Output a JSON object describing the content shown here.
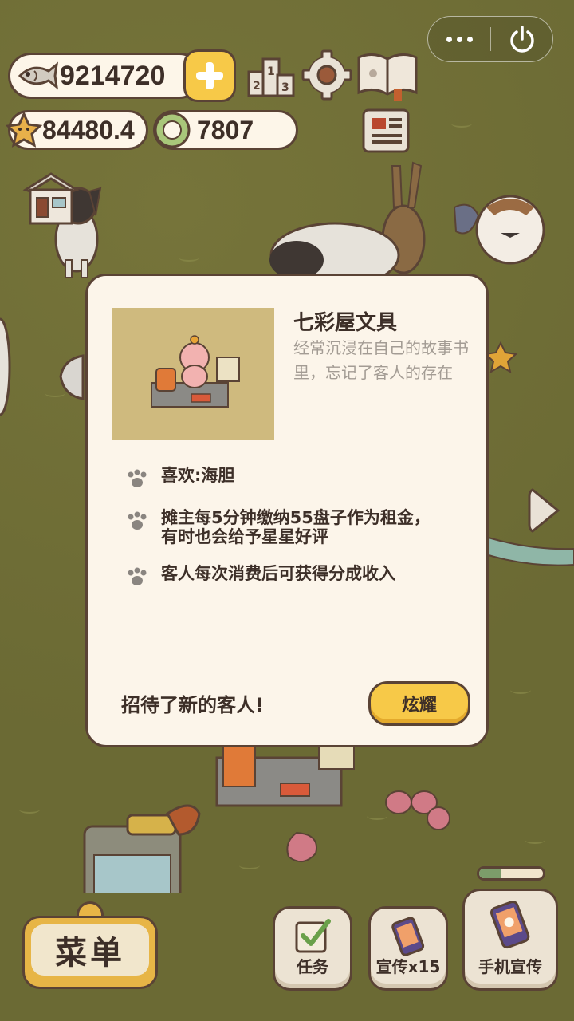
{
  "top_bar": {
    "fish_count": "9214720",
    "star_count": "84480.4",
    "coin_count": "7807"
  },
  "modal": {
    "title": "七彩屋文具",
    "description": "经常沉浸在自己的故事书里，忘记了客人的存在",
    "bullets": [
      "喜欢:海胆",
      "摊主每5分钟缴纳55盘子作为租金，\n有时也会给予星星好评",
      "客人每次消费后可获得分成收入"
    ],
    "footer_text": "招待了新的客人!",
    "show_button": "炫耀"
  },
  "bottom": {
    "menu_label": "菜单",
    "task_label": "任务",
    "promo_label": "宣传x15",
    "phone_promo_label": "手机宣传",
    "promo_progress": 0.35
  },
  "icons": {
    "fish": "fish-icon",
    "star": "star-icon",
    "coin": "coin-icon",
    "plus": "plus-icon",
    "ranking": "podium-icon",
    "settings": "gear-icon",
    "book": "book-icon",
    "news": "newspaper-icon",
    "shop": "shop-icon",
    "power": "power-icon",
    "more": "more-icon",
    "paw": "paw-icon",
    "arrow": "chevron-right-icon"
  },
  "colors": {
    "background": "#6b6a34",
    "panel": "#fcf5ea",
    "accent": "#f7c948",
    "outline": "#5a4335"
  }
}
